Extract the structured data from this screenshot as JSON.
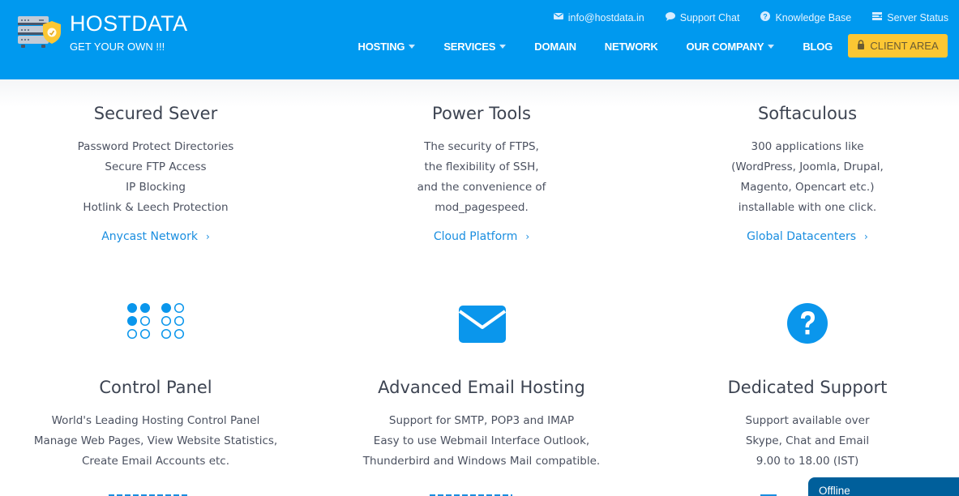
{
  "brand": {
    "title": "HOSTDATA",
    "tagline": "GET YOUR OWN !!!",
    "logo_icon": "server-shield-icon"
  },
  "topbar": [
    {
      "icon": "envelope-icon",
      "label": "info@hostdata.in"
    },
    {
      "icon": "chat-bubble-icon",
      "label": "Support Chat"
    },
    {
      "icon": "question-circle-icon",
      "label": "Knowledge Base"
    },
    {
      "icon": "server-list-icon",
      "label": "Server Status"
    }
  ],
  "nav": [
    {
      "label": "HOSTING",
      "dropdown": true
    },
    {
      "label": "SERVICES",
      "dropdown": true
    },
    {
      "label": "DOMAIN",
      "dropdown": false
    },
    {
      "label": "NETWORK",
      "dropdown": false
    },
    {
      "label": "OUR COMPANY",
      "dropdown": true
    },
    {
      "label": "BLOG",
      "dropdown": false
    }
  ],
  "client_area": {
    "label": "CLIENT AREA",
    "icon": "lock-icon"
  },
  "colors": {
    "header_bg": "#0099ef",
    "accent_yellow": "#fcc733",
    "link_blue": "#1a8ee0",
    "icon_blue": "#0a96ec",
    "chat_widget_bg": "#005f9b"
  },
  "features": [
    {
      "title": "Secured Sever",
      "lines": [
        "Password Protect Directories",
        "Secure FTP Access",
        "IP Blocking",
        "Hotlink & Leech Protection"
      ],
      "link": "Anycast Network"
    },
    {
      "title": "Power Tools",
      "lines": [
        "The security of FTPS,",
        "the flexibility of SSH,",
        "and the convenience of",
        "mod_pagespeed."
      ],
      "link": "Cloud Platform"
    },
    {
      "title": "Softaculous",
      "lines": [
        "300 applications like",
        "(WordPress, Joomla, Drupal,",
        "Magento, Opencart etc.)",
        "installable with one click."
      ],
      "link": "Global Datacenters"
    },
    {
      "title": "Control Panel",
      "icon": "control-panel-dots-icon",
      "lines": [
        "World's Leading Hosting Control Panel",
        "Manage Web Pages, View Website Statistics,",
        "Create Email Accounts etc."
      ]
    },
    {
      "title": "Advanced Email Hosting",
      "icon": "envelope-icon",
      "lines": [
        "Support for SMTP, POP3 and IMAP",
        "Easy to use Webmail Interface Outlook,",
        "Thunderbird and Windows Mail compatible."
      ]
    },
    {
      "title": "Dedicated Support",
      "icon": "question-circle-icon",
      "lines": [
        "Support available over",
        "Skype, Chat and Email",
        "9.00 to 18.00 (IST)"
      ]
    }
  ],
  "chat_widget": {
    "status": "Offline"
  },
  "link_chevron": "›"
}
